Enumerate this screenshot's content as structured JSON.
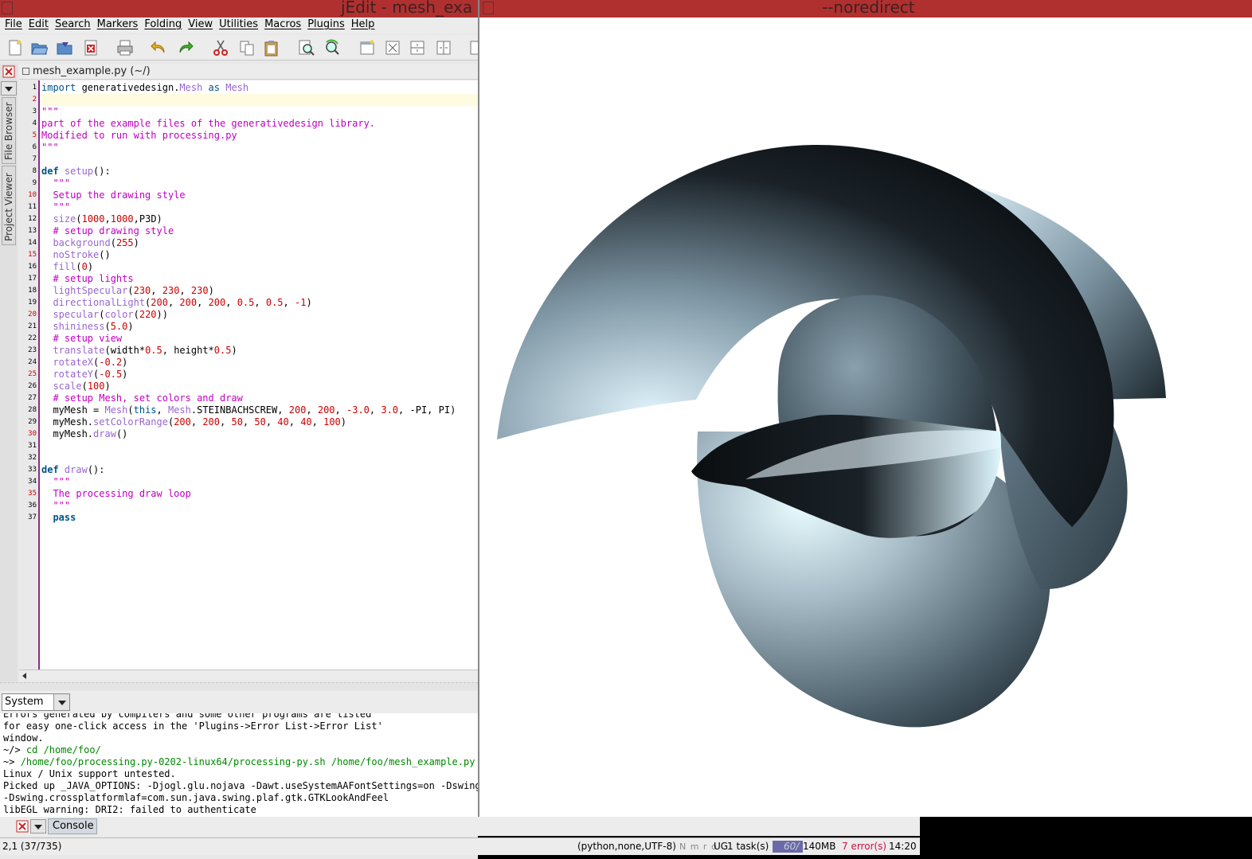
{
  "jedit_window": {
    "title": "jEdit - mesh_exa",
    "menu": [
      "File",
      "Edit",
      "Search",
      "Markers",
      "Folding",
      "View",
      "Utilities",
      "Macros",
      "Plugins",
      "Help"
    ],
    "side_tabs": [
      "File Browser",
      "Project Viewer"
    ],
    "buffer_name": "mesh_example.py (~/)",
    "code_lines": [
      "import generativedesign.Mesh as Mesh",
      "",
      "\"\"\"",
      "part of the example files of the generativedesign library.",
      "Modified to run with processing.py",
      "\"\"\"",
      "",
      "def setup():",
      "  \"\"\"",
      "  Setup the drawing style",
      "  \"\"\"",
      "  size(1000,1000,P3D)",
      "  # setup drawing style",
      "  background(255)",
      "  noStroke()",
      "  fill(0)",
      "  # setup lights",
      "  lightSpecular(230, 230, 230)",
      "  directionalLight(200, 200, 200, 0.5, 0.5, -1)",
      "  specular(color(220))",
      "  shininess(5.0)",
      "  # setup view",
      "  translate(width*0.5, height*0.5)",
      "  rotateX(-0.2)",
      "  rotateY(-0.5)",
      "  scale(100)",
      "  # setup Mesh, set colors and draw",
      "  myMesh = Mesh(this, Mesh.STEINBACHSCREW, 200, 200, -3.0, 3.0, -PI, PI)",
      "  myMesh.setColorRange(200, 200, 50, 50, 40, 40, 100)",
      "  myMesh.draw()",
      "",
      "",
      "def draw():",
      "  \"\"\"",
      "  The processing draw loop",
      "  \"\"\"",
      "  pass"
    ],
    "console": {
      "selector": "System",
      "lines": [
        "Errors generated by compilers and some other programs are listed",
        "for easy one-click access in the 'Plugins->Error List->Error List'",
        "window.",
        "~/> cd /home/foo/",
        "~> /home/foo/processing.py-0202-linux64/processing-py.sh /home/foo/mesh_example.py",
        "Linux / Unix support untested.",
        "Picked up _JAVA_OPTIONS: -Djogl.glu.nojava -Dawt.useSystemAAFontSettings=on -Dswing.aa",
        "-Dswing.crossplatformlaf=com.sun.java.swing.plaf.gtk.GTKLookAndFeel",
        "libEGL warning: DRI2: failed to authenticate"
      ],
      "tab_label": "Console"
    },
    "status": {
      "caret": "2,1 (37/735)",
      "mode": "(python,none,UTF-8)",
      "flags": "N m r o",
      "encoding_flags": "UG",
      "tasks": "1 task(s)",
      "memory_bar": "60/",
      "memory": "140MB",
      "errors": "7 error(s)",
      "time": "14:20"
    }
  },
  "sketch_window": {
    "title": "--noredirect"
  },
  "colors": {
    "titlebar": "#b03030",
    "string": "#c000c0",
    "number": "#cc0000",
    "keyword": "#00528a",
    "function": "#9966cc"
  }
}
